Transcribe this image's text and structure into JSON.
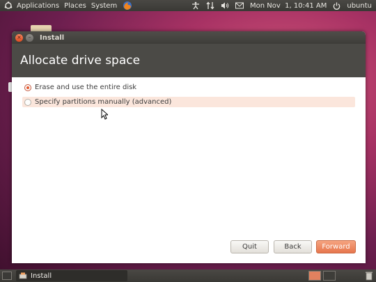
{
  "top_panel": {
    "menus": [
      "Applications",
      "Places",
      "System"
    ],
    "clock": "Mon Nov  1, 10:41 AM",
    "user": "ubuntu",
    "icons": [
      "ubuntu-logo-icon",
      "firefox-icon",
      "accessibility-icon",
      "network-icon",
      "volume-icon",
      "mail-icon",
      "power-icon"
    ]
  },
  "window": {
    "title": "Install",
    "header": "Allocate drive space",
    "options": [
      {
        "label": "Erase and use the entire disk",
        "selected": true
      },
      {
        "label": "Specify partitions manually (advanced)",
        "selected": false
      }
    ],
    "buttons": {
      "quit": "Quit",
      "back": "Back",
      "forward": "Forward"
    }
  },
  "bottom_panel": {
    "task_label": "Install"
  },
  "colors": {
    "accent": "#e7764d",
    "header_bg": "#4b4a46",
    "panel_bg": "#3c3b37",
    "highlight_row": "#fbe6dc"
  }
}
